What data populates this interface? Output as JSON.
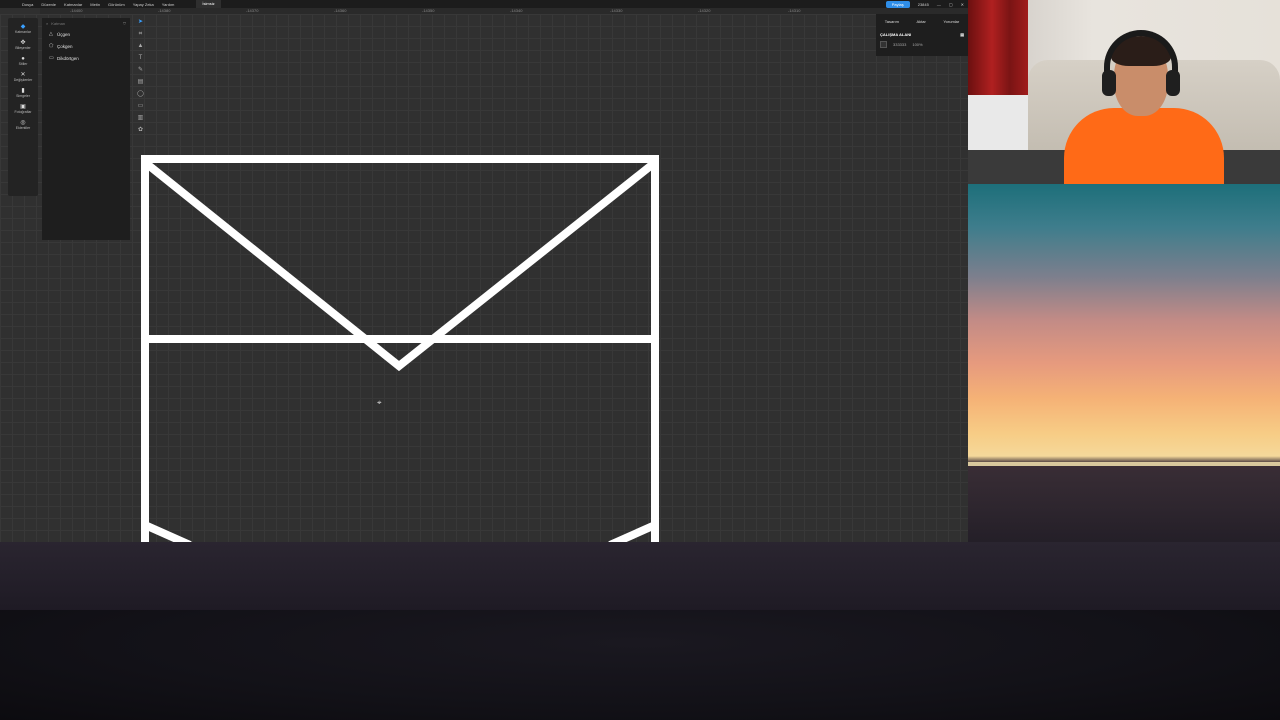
{
  "app": {
    "menu": [
      "Dosya",
      "Düzenle",
      "Katmanlar",
      "Metin",
      "Görünüm",
      "Yapay Zeka",
      "Yardım"
    ],
    "tab_title": "İsimsiz",
    "share_label": "Paylaş",
    "zoom_readout": "23845"
  },
  "ruler": [
    "-14400",
    "-14380",
    "-14370",
    "-14360",
    "-14350",
    "-14340",
    "-14330",
    "-14320",
    "-14310"
  ],
  "iconbar": [
    {
      "label": "Katmanlar",
      "icon": "layers-icon",
      "glyph": "◆",
      "active": true
    },
    {
      "label": "Bileşenler",
      "icon": "components-icon",
      "glyph": "✥",
      "active": false
    },
    {
      "label": "Stiller",
      "icon": "styles-icon",
      "glyph": "●",
      "active": false
    },
    {
      "label": "Değişkenler",
      "icon": "variables-icon",
      "glyph": "✕",
      "active": false
    },
    {
      "label": "Simgeler",
      "icon": "icons-icon",
      "glyph": "▮",
      "active": false
    },
    {
      "label": "Fotoğraflar",
      "icon": "photos-icon",
      "glyph": "▣",
      "active": false
    },
    {
      "label": "Eklentiler",
      "icon": "plugins-icon",
      "glyph": "◎",
      "active": false
    }
  ],
  "layers": {
    "search_placeholder": "Katman",
    "items": [
      {
        "label": "Üçgen",
        "shape": "△"
      },
      {
        "label": "Çokgen",
        "shape": "⬠"
      },
      {
        "label": "Dikdörtgen",
        "shape": "▭"
      }
    ]
  },
  "tools": [
    "➤",
    "⌗",
    "▲",
    "T",
    "✎",
    "▤",
    "◯",
    "▭",
    "▥",
    "✿"
  ],
  "right_panel": {
    "tabs": [
      "Tasarım",
      "Aktar",
      "Yorumlar"
    ],
    "section_title": "ÇALIŞMA ALANI",
    "fill_hex": "333333",
    "opacity": "100%"
  },
  "colors": {
    "canvas": "#303030",
    "stroke": "#ffffff",
    "accent": "#2f8ee8"
  }
}
